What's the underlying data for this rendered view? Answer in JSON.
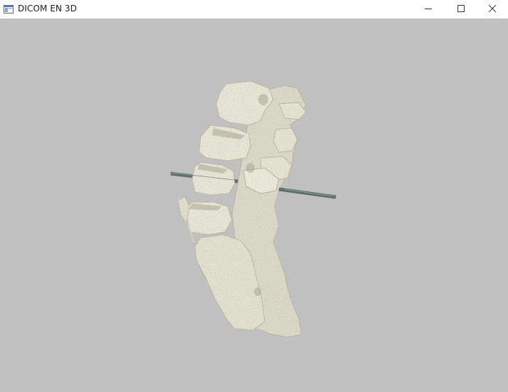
{
  "window": {
    "title": "DICOM EN 3D",
    "app_icon": "app-window-icon",
    "controls": {
      "minimize_icon": "minimize-icon",
      "maximize_icon": "maximize-icon",
      "close_icon": "close-icon"
    }
  },
  "viewport": {
    "background_color": "#c0c0c0",
    "bone_color": "#e9e6d8",
    "rod_color": "#5f6f6c"
  }
}
